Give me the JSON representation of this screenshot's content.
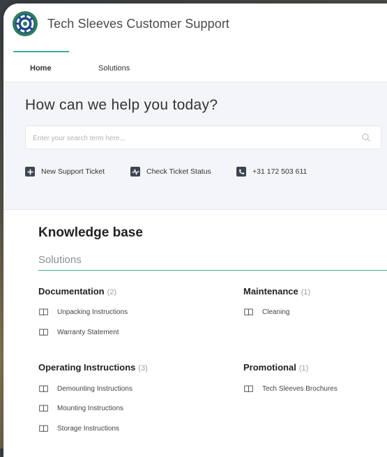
{
  "header": {
    "title": "Tech Sleeves Customer Support"
  },
  "nav": {
    "tabs": [
      {
        "label": "Home"
      },
      {
        "label": "Solutions"
      }
    ]
  },
  "hero": {
    "title": "How can we help you today?",
    "search": {
      "placeholder": "Enter your search term here...",
      "value": ""
    },
    "actions": [
      {
        "label": "New Support Ticket",
        "icon": "plus-icon"
      },
      {
        "label": "Check Ticket Status",
        "icon": "activity-icon"
      },
      {
        "label": "+31 172 503 611",
        "icon": "phone-icon"
      }
    ]
  },
  "kb": {
    "title": "Knowledge base",
    "subtitle": "Solutions",
    "categories": [
      {
        "name": "Documentation",
        "count": "(2)",
        "articles": [
          "Unpacking Instructions",
          "Warranty Statement"
        ]
      },
      {
        "name": "Maintenance",
        "count": "(1)",
        "articles": [
          "Cleaning"
        ]
      },
      {
        "name": "Operating Instructions",
        "count": "(3)",
        "articles": [
          "Demounting Instructions",
          "Mounting Instructions",
          "Storage Instructions"
        ]
      },
      {
        "name": "Promotional",
        "count": "(1)",
        "articles": [
          "Tech Sleeves Brochures"
        ]
      }
    ]
  },
  "colors": {
    "accent": "#3bb08f",
    "icon_dark": "#3e4551"
  }
}
